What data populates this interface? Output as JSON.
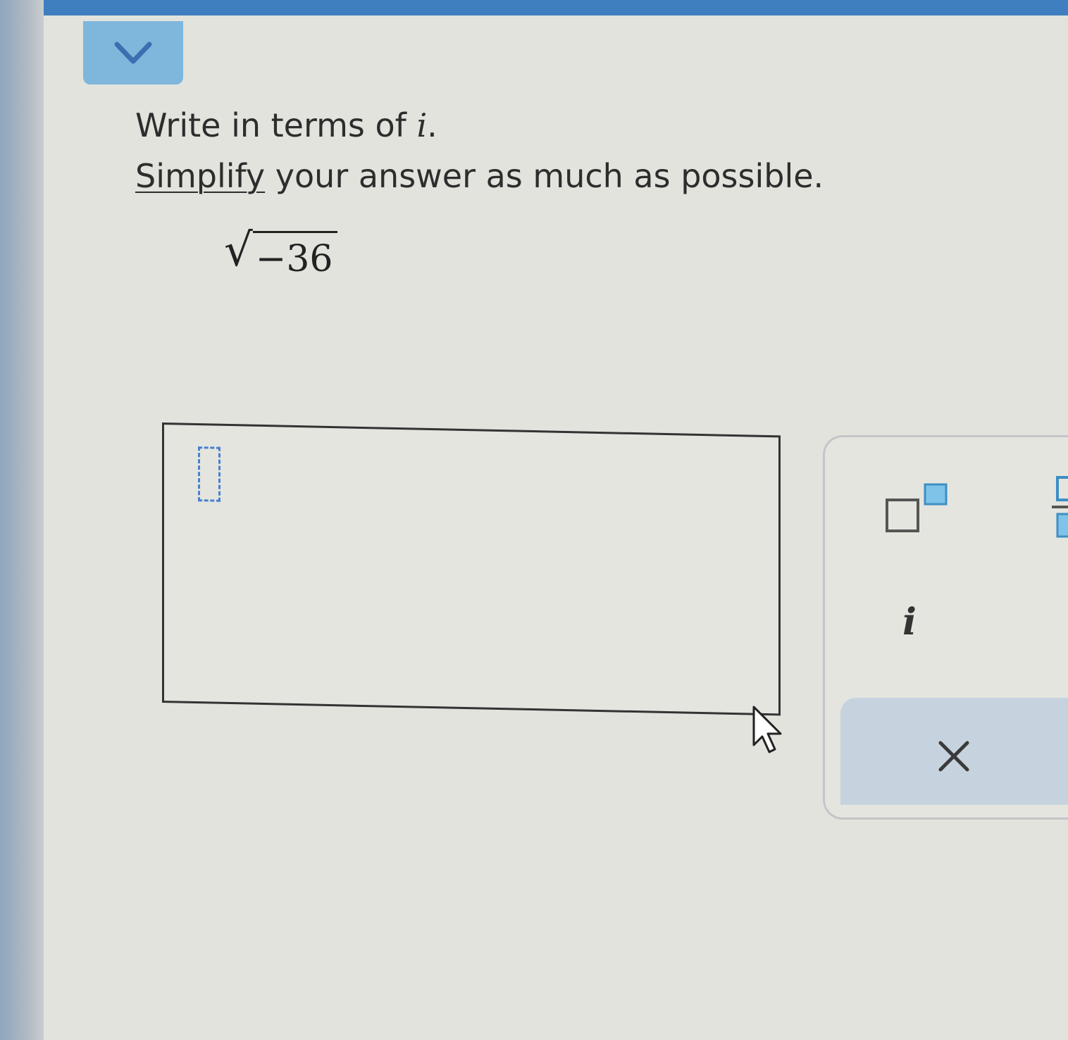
{
  "header": {
    "collapse_icon": "chevron-down-icon",
    "accent_color": "#7fb6dc"
  },
  "question": {
    "line1_prefix": "Write in terms of ",
    "line1_variable": "i",
    "line1_suffix": ".",
    "simplify_link": "Simplify",
    "line2_rest": " your answer as much as possible."
  },
  "expression": {
    "radical_symbol": "√",
    "radicand": "−36"
  },
  "answer": {
    "value": "",
    "placeholder_icon": "empty-slot-icon"
  },
  "palette": {
    "superscript_icon": "superscript-template-icon",
    "fraction_icon": "fraction-template-icon",
    "i_label": "i",
    "clear_icon": "close-icon"
  },
  "cursor": {
    "icon": "mouse-pointer-icon"
  }
}
